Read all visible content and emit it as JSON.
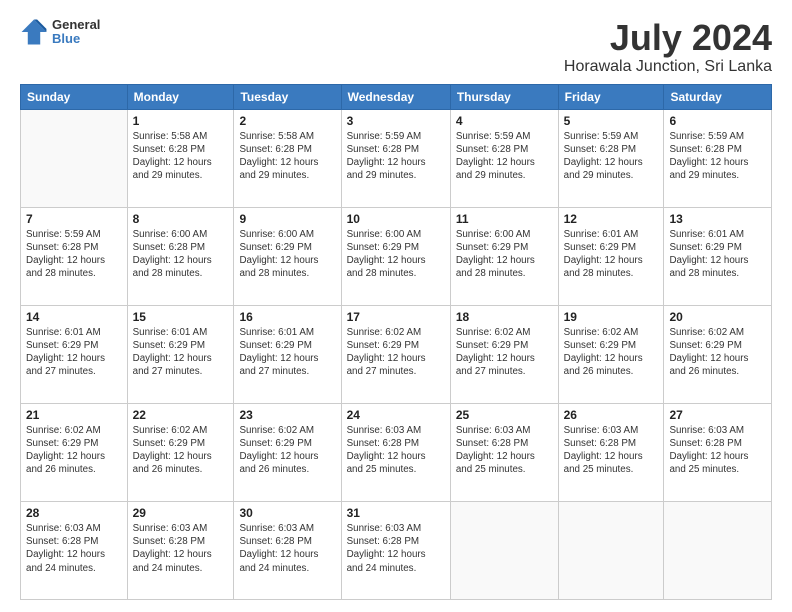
{
  "logo": {
    "line1": "General",
    "line2": "Blue"
  },
  "title": "July 2024",
  "subtitle": "Horawala Junction, Sri Lanka",
  "days_of_week": [
    "Sunday",
    "Monday",
    "Tuesday",
    "Wednesday",
    "Thursday",
    "Friday",
    "Saturday"
  ],
  "weeks": [
    [
      {
        "day": "",
        "info": ""
      },
      {
        "day": "1",
        "info": "Sunrise: 5:58 AM\nSunset: 6:28 PM\nDaylight: 12 hours\nand 29 minutes."
      },
      {
        "day": "2",
        "info": "Sunrise: 5:58 AM\nSunset: 6:28 PM\nDaylight: 12 hours\nand 29 minutes."
      },
      {
        "day": "3",
        "info": "Sunrise: 5:59 AM\nSunset: 6:28 PM\nDaylight: 12 hours\nand 29 minutes."
      },
      {
        "day": "4",
        "info": "Sunrise: 5:59 AM\nSunset: 6:28 PM\nDaylight: 12 hours\nand 29 minutes."
      },
      {
        "day": "5",
        "info": "Sunrise: 5:59 AM\nSunset: 6:28 PM\nDaylight: 12 hours\nand 29 minutes."
      },
      {
        "day": "6",
        "info": "Sunrise: 5:59 AM\nSunset: 6:28 PM\nDaylight: 12 hours\nand 29 minutes."
      }
    ],
    [
      {
        "day": "7",
        "info": "Sunrise: 5:59 AM\nSunset: 6:28 PM\nDaylight: 12 hours\nand 28 minutes."
      },
      {
        "day": "8",
        "info": "Sunrise: 6:00 AM\nSunset: 6:28 PM\nDaylight: 12 hours\nand 28 minutes."
      },
      {
        "day": "9",
        "info": "Sunrise: 6:00 AM\nSunset: 6:29 PM\nDaylight: 12 hours\nand 28 minutes."
      },
      {
        "day": "10",
        "info": "Sunrise: 6:00 AM\nSunset: 6:29 PM\nDaylight: 12 hours\nand 28 minutes."
      },
      {
        "day": "11",
        "info": "Sunrise: 6:00 AM\nSunset: 6:29 PM\nDaylight: 12 hours\nand 28 minutes."
      },
      {
        "day": "12",
        "info": "Sunrise: 6:01 AM\nSunset: 6:29 PM\nDaylight: 12 hours\nand 28 minutes."
      },
      {
        "day": "13",
        "info": "Sunrise: 6:01 AM\nSunset: 6:29 PM\nDaylight: 12 hours\nand 28 minutes."
      }
    ],
    [
      {
        "day": "14",
        "info": "Sunrise: 6:01 AM\nSunset: 6:29 PM\nDaylight: 12 hours\nand 27 minutes."
      },
      {
        "day": "15",
        "info": "Sunrise: 6:01 AM\nSunset: 6:29 PM\nDaylight: 12 hours\nand 27 minutes."
      },
      {
        "day": "16",
        "info": "Sunrise: 6:01 AM\nSunset: 6:29 PM\nDaylight: 12 hours\nand 27 minutes."
      },
      {
        "day": "17",
        "info": "Sunrise: 6:02 AM\nSunset: 6:29 PM\nDaylight: 12 hours\nand 27 minutes."
      },
      {
        "day": "18",
        "info": "Sunrise: 6:02 AM\nSunset: 6:29 PM\nDaylight: 12 hours\nand 27 minutes."
      },
      {
        "day": "19",
        "info": "Sunrise: 6:02 AM\nSunset: 6:29 PM\nDaylight: 12 hours\nand 26 minutes."
      },
      {
        "day": "20",
        "info": "Sunrise: 6:02 AM\nSunset: 6:29 PM\nDaylight: 12 hours\nand 26 minutes."
      }
    ],
    [
      {
        "day": "21",
        "info": "Sunrise: 6:02 AM\nSunset: 6:29 PM\nDaylight: 12 hours\nand 26 minutes."
      },
      {
        "day": "22",
        "info": "Sunrise: 6:02 AM\nSunset: 6:29 PM\nDaylight: 12 hours\nand 26 minutes."
      },
      {
        "day": "23",
        "info": "Sunrise: 6:02 AM\nSunset: 6:29 PM\nDaylight: 12 hours\nand 26 minutes."
      },
      {
        "day": "24",
        "info": "Sunrise: 6:03 AM\nSunset: 6:28 PM\nDaylight: 12 hours\nand 25 minutes."
      },
      {
        "day": "25",
        "info": "Sunrise: 6:03 AM\nSunset: 6:28 PM\nDaylight: 12 hours\nand 25 minutes."
      },
      {
        "day": "26",
        "info": "Sunrise: 6:03 AM\nSunset: 6:28 PM\nDaylight: 12 hours\nand 25 minutes."
      },
      {
        "day": "27",
        "info": "Sunrise: 6:03 AM\nSunset: 6:28 PM\nDaylight: 12 hours\nand 25 minutes."
      }
    ],
    [
      {
        "day": "28",
        "info": "Sunrise: 6:03 AM\nSunset: 6:28 PM\nDaylight: 12 hours\nand 24 minutes."
      },
      {
        "day": "29",
        "info": "Sunrise: 6:03 AM\nSunset: 6:28 PM\nDaylight: 12 hours\nand 24 minutes."
      },
      {
        "day": "30",
        "info": "Sunrise: 6:03 AM\nSunset: 6:28 PM\nDaylight: 12 hours\nand 24 minutes."
      },
      {
        "day": "31",
        "info": "Sunrise: 6:03 AM\nSunset: 6:28 PM\nDaylight: 12 hours\nand 24 minutes."
      },
      {
        "day": "",
        "info": ""
      },
      {
        "day": "",
        "info": ""
      },
      {
        "day": "",
        "info": ""
      }
    ]
  ]
}
